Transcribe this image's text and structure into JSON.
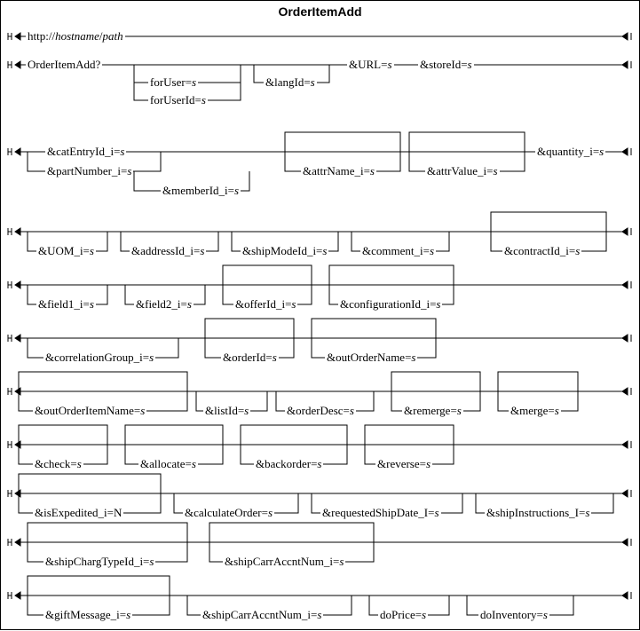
{
  "title": "OrderItemAdd",
  "tokens": {
    "url_prefix": "http://",
    "url_host": "hostname",
    "url_slash": "/",
    "url_path": "path",
    "cmd": "OrderItemAdd?",
    "forUser": "forUser=",
    "forUserId": "forUserId=",
    "langId": "&langId=",
    "URL": "&URL=",
    "storeId": "&storeId=",
    "catEntryId": "&catEntryId_i=",
    "partNumber": "&partNumber_i=",
    "memberId": "&memberId_i=",
    "attrName": "&attrName_i=",
    "attrValue": "&attrValue_i=",
    "quantity": "&quantity_i=",
    "UOM": "&UOM_i=",
    "addressId": "&addressId_i=",
    "shipModeId": "&shipModeId_i=",
    "comment": "&comment_i=",
    "contractId": "&contractId_i=",
    "field1": "&field1_i=",
    "field2": "&field2_i=",
    "offerId": "&offerId_i=",
    "configurationId": "&configurationId_i=",
    "correlationGroup": "&correlationGroup_i=",
    "orderId": "&orderId=",
    "outOrderName": "&outOrderName=",
    "outOrderItemName": "&outOrderItemName=",
    "listId": "&listId=",
    "orderDesc": "&orderDesc=",
    "remerge": "&remerge=",
    "merge": "&merge=",
    "check": "&check=",
    "allocate": "&allocate=",
    "backorder": "&backorder=",
    "reverse": "&reverse=",
    "isExpedited": "&isExpedited_i=",
    "calculateOrder": "&calculateOrder=",
    "requestedShipDate": "&requestedShipDate_I=",
    "shipInstructions": "&shipInstructions_I=",
    "shipChargTypeId": "&shipChargTypeId_i=",
    "shipCarrAccntNum1": "&shipCarrAccntNum_i=",
    "giftMessage": "&giftMessage_i=",
    "shipCarrAccntNum2": "&shipCarrAccntNum_i=",
    "doPrice": "doPrice=",
    "doInventory": "doInventory=",
    "s": "s",
    "N": "N"
  }
}
